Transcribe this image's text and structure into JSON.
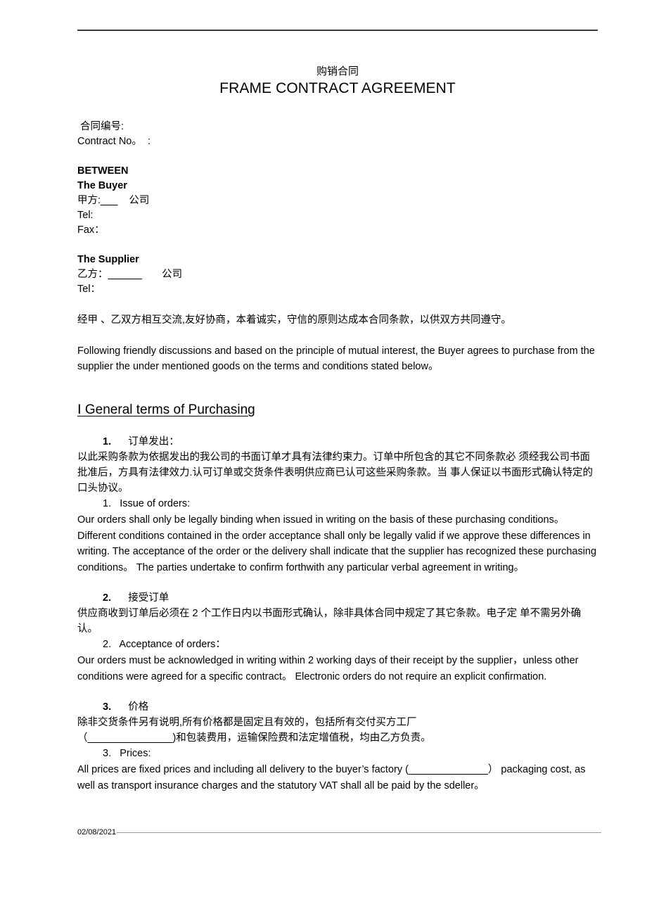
{
  "document": {
    "title_cn": "购销合同",
    "title_en": "FRAME CONTRACT AGREEMENT"
  },
  "header": {
    "rule": "horizontal-rule"
  },
  "contract_no": {
    "label_cn": " 合同编号:",
    "label_en": "Contract No。  :"
  },
  "parties": {
    "between_label": "BETWEEN",
    "buyer": {
      "heading": "The Buyer",
      "name_prefix_cn": "甲方:",
      "name_blank": "___",
      "name_suffix_cn": "    公司",
      "tel_label": "Tel:",
      "fax_label": "Fax："
    },
    "supplier": {
      "heading": "The Supplier",
      "name_prefix_cn": "乙方：",
      "name_blank": "______",
      "name_suffix_cn": "       公司",
      "tel_label": "Tel："
    }
  },
  "intro": {
    "cn": "经甲 、乙双方相互交流,友好协商，本着诚实，守信的原则达成本合同条款，以供双方共同遵守。",
    "en": "Following friendly discussions and based on the principle of mutual interest, the Buyer agrees to purchase from the supplier the under mentioned goods on the terms and conditions stated below。"
  },
  "section": {
    "heading": "Ⅰ General terms of Purchasing"
  },
  "clauses": [
    {
      "num": "1.",
      "title_cn": "订单发出：",
      "body_cn": "以此采购条款为依据发出的我公司的书面订单才具有法律约束力。订单中所包含的其它不同条款必 须经我公司书面批准后，方具有法律效力.认可订单或交货条件表明供应商已认可这些采购条款。当 事人保证以书面形式确认特定的口头协议。",
      "num_en": "1.",
      "title_en": "Issue of orders:",
      "body_en": "Our orders shall only be legally binding when issued in writing on the basis of these purchasing conditions。  Different conditions contained in the order acceptance shall only be legally valid if we approve these differences in writing. The acceptance of the order or the delivery shall indicate that the supplier has recognized these purchasing conditions。  The parties undertake to confirm forthwith any particular verbal agreement in writing。"
    },
    {
      "num": "2.",
      "title_cn": "接受订单",
      "body_cn": "供应商收到订单后必须在 2  个工作日内以书面形式确认，除非具体合同中规定了其它条款。电子定 单不需另外确认。",
      "num_en": "2.",
      "title_en": "Acceptance of orders：",
      "body_en": "Our orders must be acknowledged in writing within 2 working days of their receipt by the supplier，unless other conditions were agreed for a specific contract。  Electronic orders do not require an explicit confirmation."
    },
    {
      "num": "3.",
      "title_cn": "价格",
      "body_cn_line1": "除非交货条件另有说明,所有价格都是固定且有效的，包括所有交付买方工厂",
      "body_cn_line2_pre": "（",
      "body_cn_line2_blank": "_______________",
      "body_cn_line2_post": ")和包装费用，运输保险费和法定增值税，均由乙方负责。",
      "num_en": "3.",
      "title_en": "Prices:",
      "body_en_pre": "All prices are fixed prices and including all delivery to the buyer’s factory (",
      "body_en_blank": "______________",
      "body_en_post": "）  packaging cost, as well as transport insurance charges and the statutory VAT shall all be paid by the sdeller。"
    }
  ],
  "footer": {
    "date": "02/08/2021"
  },
  "colors": {
    "text": "#000000",
    "header_rule": "#3a3a3a",
    "footer_rule": "#9a9a9a",
    "page_background": "#ffffff"
  }
}
